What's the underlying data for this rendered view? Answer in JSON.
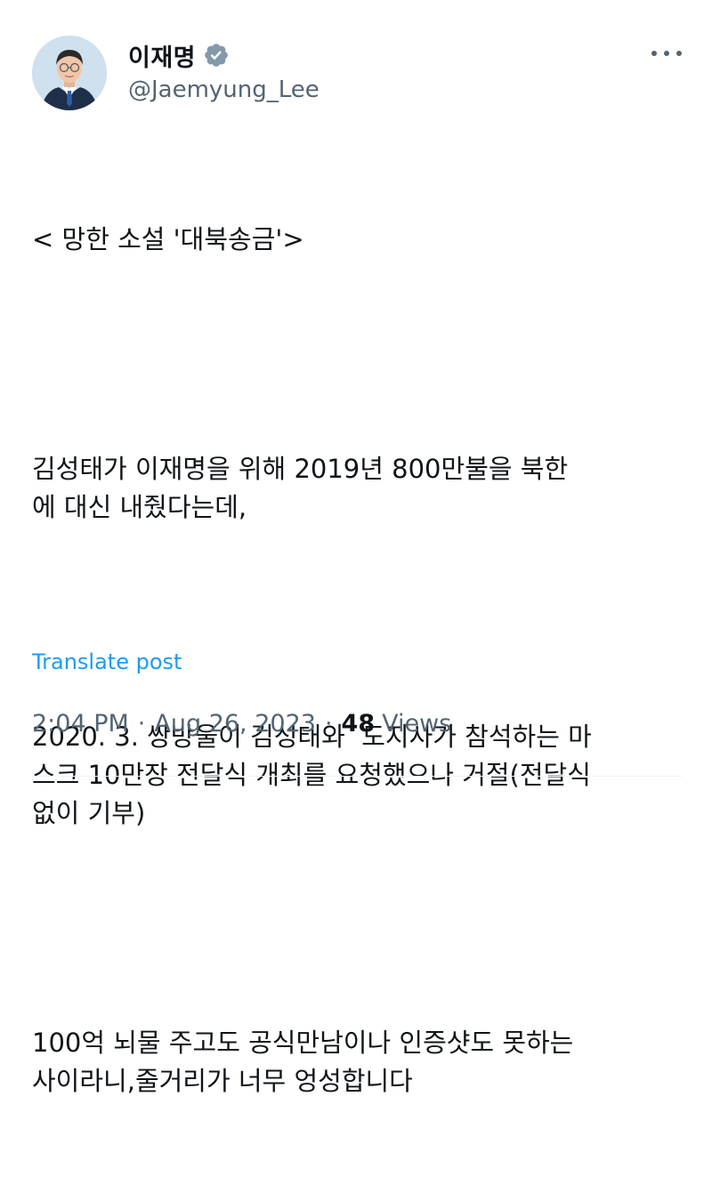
{
  "author": {
    "display_name": "이재명",
    "handle": "@Jaemyung_Lee",
    "verified": true
  },
  "post": {
    "paragraphs": [
      [
        "< 망한 소설 '대북송금'>"
      ],
      [
        "김성태가 이재명을 위해 2019년 800만불을 북한",
        "에 대신 내줬다는데,"
      ],
      [
        "2020. 3. 쌍방울이 김성태와  도지사가 참석하는 마",
        "스크 10만장 전달식 개최를 요청했으나 거절(전달식",
        "없이 기부)"
      ],
      [
        "100억 뇌물 주고도 공식만남이나 인증샷도 못하는",
        "사이라니,줄거리가 너무 엉성합니다"
      ]
    ],
    "translate_label": "Translate post"
  },
  "meta": {
    "time": "2:04 PM",
    "separator": "·",
    "date": "Aug 26, 2023",
    "views_count": "48",
    "views_label": "Views"
  },
  "colors": {
    "accent": "#1d9bf0",
    "text": "#0f1419",
    "muted": "#536471",
    "verified_badge": "#829aab"
  },
  "icons": {
    "verified": "verified-badge-icon",
    "more": "more-options-icon"
  }
}
